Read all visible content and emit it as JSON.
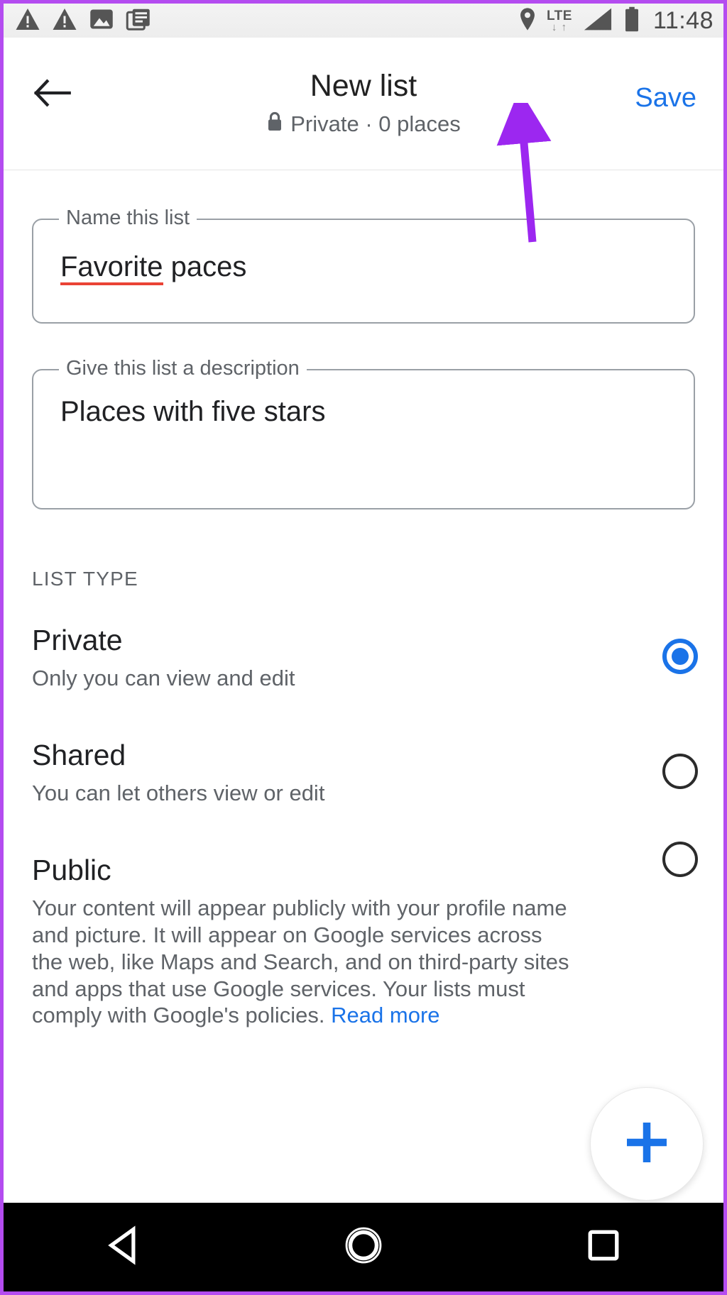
{
  "status_bar": {
    "icons": [
      "warning-triangle-icon",
      "warning-triangle-icon",
      "photo-image-icon",
      "document-stack-icon"
    ],
    "location_icon": "location-pin-icon",
    "network_type": "LTE",
    "data_arrows": "↓ ↑",
    "signal_icon": "signal-bars-icon",
    "battery_icon": "battery-full-icon",
    "time": "11:48"
  },
  "app_bar": {
    "back_icon": "back-arrow-icon",
    "title": "New list",
    "lock_icon": "lock-icon",
    "subtitle": "Private · 0 places",
    "save_label": "Save"
  },
  "form": {
    "name_field": {
      "label": "Name this list",
      "value_misspelled": "Favorite",
      "value_rest": " paces",
      "full_value": "Favorite paces"
    },
    "description_field": {
      "label": "Give this list a description",
      "value": "Places with five stars"
    }
  },
  "list_type": {
    "section_label": "LIST TYPE",
    "options": [
      {
        "title": "Private",
        "description": "Only you can view and edit",
        "selected": true
      },
      {
        "title": "Shared",
        "description": "You can let others view or edit",
        "selected": false
      },
      {
        "title": "Public",
        "description": "Your content will appear publicly with your profile name and picture. It will appear on Google services across the web, like Maps and Search, and on third-party sites and apps that use Google services. Your lists must comply with Google's policies. ",
        "link_label": "Read more",
        "selected": false
      }
    ]
  },
  "fab": {
    "icon": "plus-icon",
    "label": "Add place"
  },
  "nav_bar": {
    "back": "back-triangle-icon",
    "home": "home-circle-icon",
    "recents": "recents-square-icon"
  },
  "annotation": {
    "type": "arrow",
    "points_to": "Save",
    "color": "#9c27f0"
  },
  "colors": {
    "accent_blue": "#1a73e8",
    "text_primary": "#202124",
    "text_secondary": "#5f6368",
    "border_gray": "#9aa0a6",
    "spellcheck_red": "#ea4335",
    "annotation_purple": "#9c27f0",
    "device_frame": "#b44cf0"
  }
}
